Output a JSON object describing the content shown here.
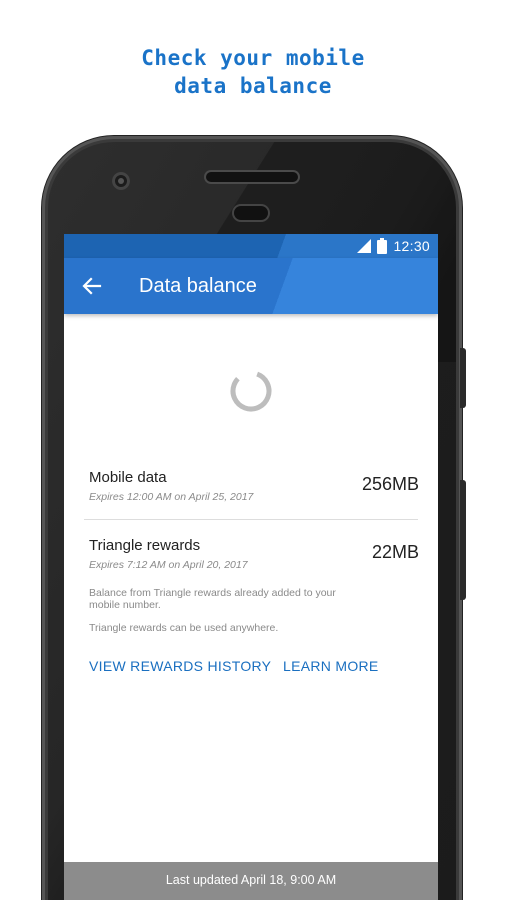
{
  "promo": {
    "line1": "Check your mobile",
    "line2": "data balance"
  },
  "status_bar": {
    "time": "12:30",
    "icons": [
      "signal-icon",
      "battery-icon"
    ]
  },
  "app_bar": {
    "title": "Data balance",
    "back_icon": "arrow-back-icon"
  },
  "balances": [
    {
      "label": "Mobile data",
      "expires": "Expires 12:00 AM on April 25, 2017",
      "value": "256MB"
    },
    {
      "label": "Triangle rewards",
      "expires": "Expires 7:12 AM on April 20, 2017",
      "value": "22MB"
    }
  ],
  "notes": {
    "rewards_added": "Balance from Triangle rewards already added to your mobile number.",
    "rewards_anywhere": "Triangle rewards can be used anywhere."
  },
  "actions": {
    "view_history": "VIEW REWARDS HISTORY",
    "learn_more": "LEARN MORE"
  },
  "footer": {
    "last_updated": "Last updated April 18, 9:00 AM"
  },
  "colors": {
    "accent": "#2a74cc",
    "link": "#1a6fc0",
    "headline": "#1a73c8",
    "footer": "#8c8c8c"
  }
}
